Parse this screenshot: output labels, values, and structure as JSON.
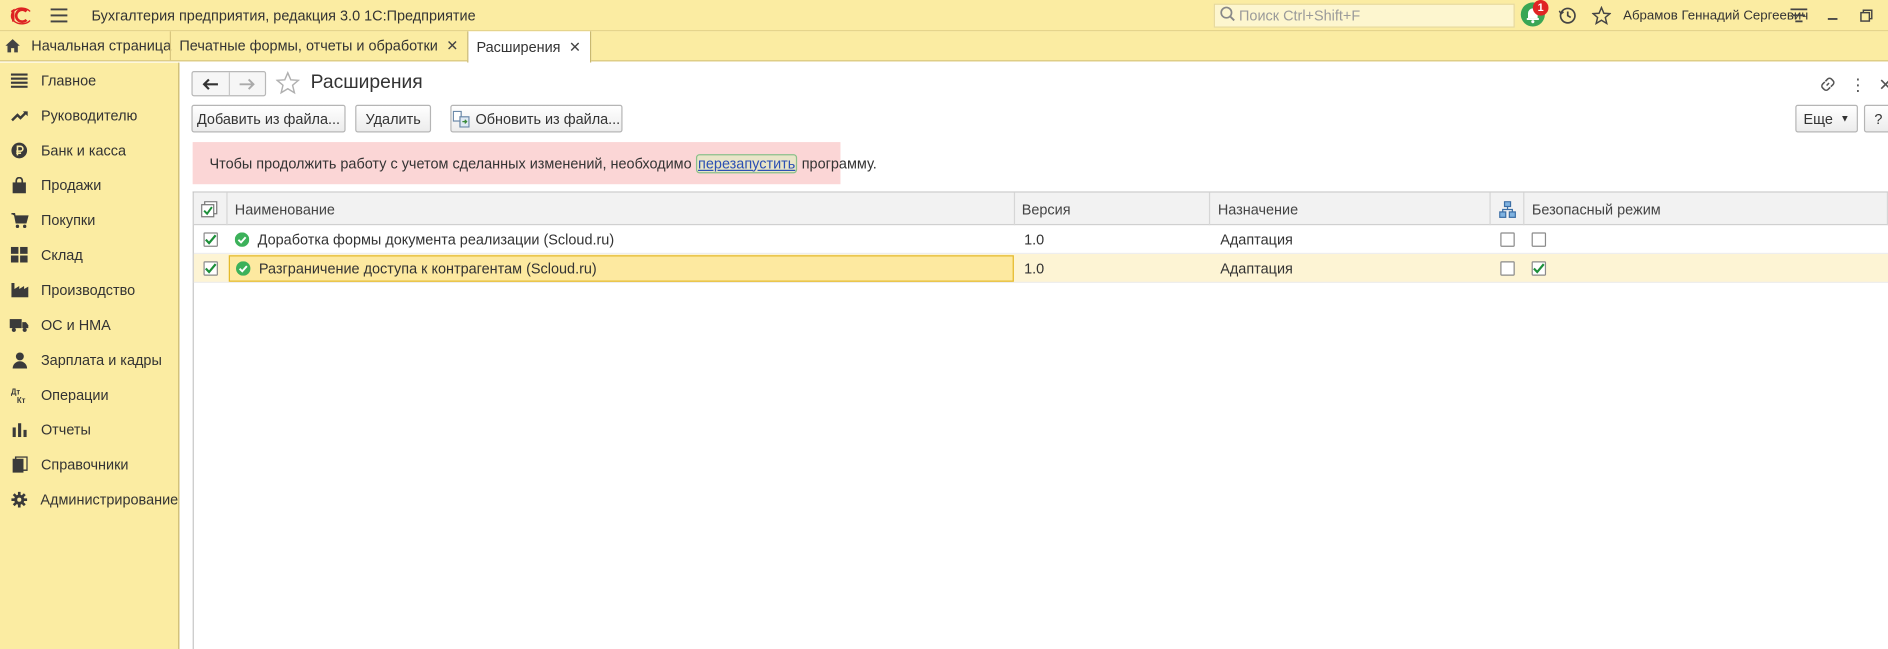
{
  "app": {
    "title": "Бухгалтерия предприятия, редакция 3.0 1С:Предприятие",
    "search_placeholder": "Поиск Ctrl+Shift+F",
    "notifications_count": "1",
    "user_name": "Абрамов Геннадий Сергеевич"
  },
  "tabs": {
    "home_label": "Начальная страница",
    "items": [
      {
        "label": "Печатные формы, отчеты и обработки",
        "active": false
      },
      {
        "label": "Расширения",
        "active": true
      }
    ],
    "close_glyph": "✕"
  },
  "sidebar": {
    "items": [
      {
        "label": "Главное",
        "icon": "menu-lines-icon"
      },
      {
        "label": "Руководителю",
        "icon": "trend-icon"
      },
      {
        "label": "Банк и касса",
        "icon": "ruble-coin-icon"
      },
      {
        "label": "Продажи",
        "icon": "shopping-bag-icon"
      },
      {
        "label": "Покупки",
        "icon": "cart-icon"
      },
      {
        "label": "Склад",
        "icon": "warehouse-grid-icon"
      },
      {
        "label": "Производство",
        "icon": "factory-icon"
      },
      {
        "label": "ОС и НМА",
        "icon": "truck-icon"
      },
      {
        "label": "Зарплата и кадры",
        "icon": "person-icon"
      },
      {
        "label": "Операции",
        "icon": "dt-kt-icon"
      },
      {
        "label": "Отчеты",
        "icon": "bar-chart-icon"
      },
      {
        "label": "Справочники",
        "icon": "books-icon"
      },
      {
        "label": "Администрирование",
        "icon": "gear-icon"
      }
    ]
  },
  "page": {
    "title": "Расширения",
    "more_glyph": "⋮",
    "close_glyph": "✕"
  },
  "toolbar": {
    "add_from_file": "Добавить из файла...",
    "delete": "Удалить",
    "update_from_file": "Обновить из файла...",
    "more": "Еще",
    "help": "?"
  },
  "warning": {
    "before_link": "Чтобы продолжить работу с учетом сделанных изменений, необходимо ",
    "link": "перезапустить",
    "after_link": " программу."
  },
  "table": {
    "columns": {
      "name": "Наименование",
      "version": "Версия",
      "purpose": "Назначение",
      "safe_mode": "Безопасный режим"
    },
    "rows": [
      {
        "active": true,
        "name": "Доработка формы документа реализации (Scloud.ru)",
        "version": "1.0",
        "purpose": "Адаптация",
        "col4": false,
        "safe_mode": false,
        "selected": false
      },
      {
        "active": true,
        "name": "Разграничение доступа к контрагентам (Scloud.ru)",
        "version": "1.0",
        "purpose": "Адаптация",
        "col4": false,
        "safe_mode": true,
        "selected": true
      }
    ]
  },
  "colors": {
    "panel": "#fbeca2",
    "warning_bg": "#fbd6d6",
    "selection": "#fde9a0",
    "ok_green": "#3cb15a",
    "check_green": "#1d8f3a"
  }
}
